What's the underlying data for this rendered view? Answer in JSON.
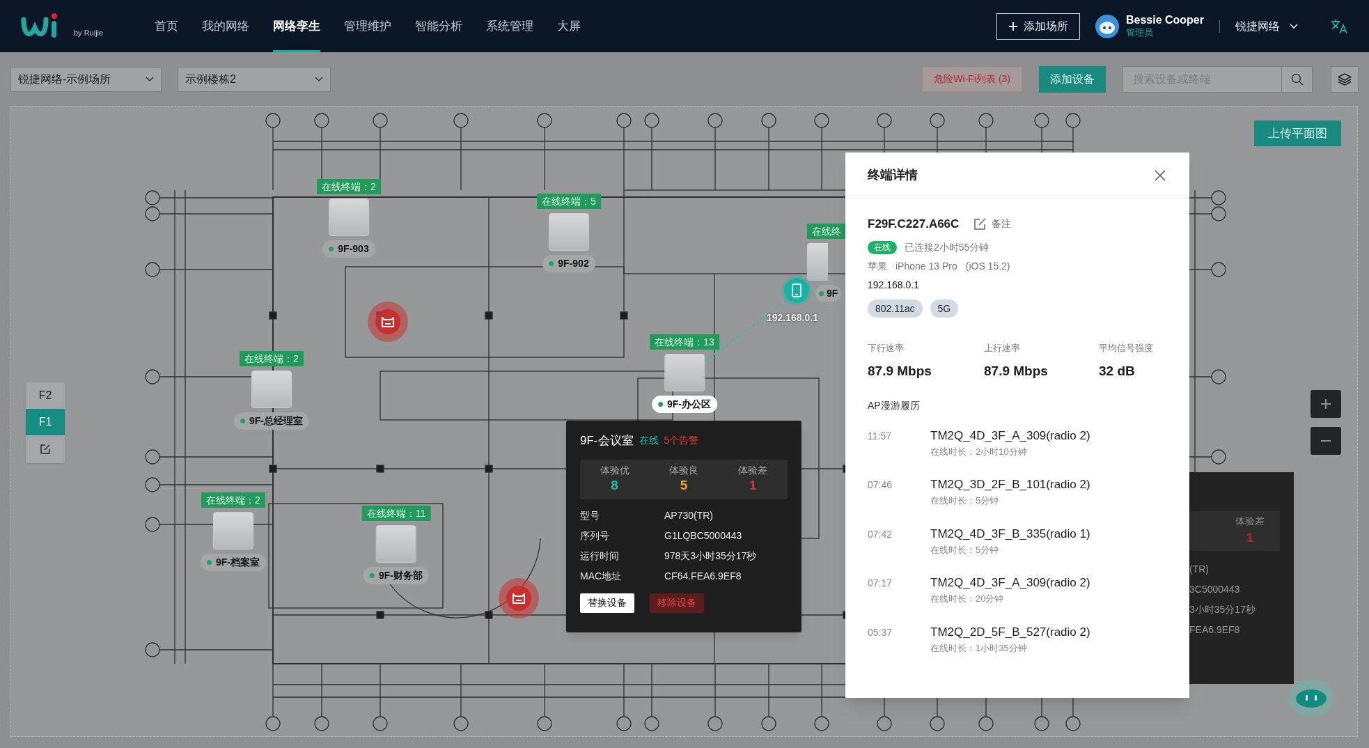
{
  "nav": {
    "logo_caption": "by Ruijie",
    "items": [
      {
        "label": "首页",
        "selected": false
      },
      {
        "label": "我的网络",
        "selected": false
      },
      {
        "label": "网络孪生",
        "selected": true
      },
      {
        "label": "管理维护",
        "selected": false
      },
      {
        "label": "智能分析",
        "selected": false
      },
      {
        "label": "系统管理",
        "selected": false
      },
      {
        "label": "大屏",
        "selected": false
      }
    ],
    "add_site_button": "添加场所",
    "user": {
      "name": "Bessie Cooper",
      "role": "管理员"
    },
    "org": "锐捷网络"
  },
  "toolbar": {
    "site_select": "锐捷网络-示例场所",
    "building_select": "示例楼栋2",
    "wifi_risk_button": "危险Wi-Fi列表 (3)",
    "add_device_button": "添加设备",
    "search": {
      "placeholder": "搜索设备或终端"
    }
  },
  "canvas": {
    "upload_button": "上传平面图",
    "floors": [
      {
        "label": "F2",
        "selected": false
      },
      {
        "label": "F1",
        "selected": true
      }
    ],
    "aps": [
      {
        "name": "9F-903",
        "badge": "在线终端：2",
        "online": true,
        "selected": false
      },
      {
        "name": "9F-902",
        "badge": "在线终端：5",
        "online": true,
        "selected": false
      },
      {
        "name": "9F-总经理室",
        "badge": "在线终端：2",
        "online": true,
        "selected": false
      },
      {
        "name": "9F-档案室",
        "badge": "在线终端：2",
        "online": true,
        "selected": false
      },
      {
        "name": "9F-财务部",
        "badge": "在线终端：11",
        "online": true,
        "selected": false
      },
      {
        "name": "9F-办公区",
        "badge": "在线终端：13",
        "online": true,
        "selected": true
      },
      {
        "name": "9F",
        "badge": "在线终",
        "online": true,
        "selected": false
      }
    ],
    "terminal": {
      "ip": "192.168.0.1"
    }
  },
  "ap_popup": {
    "name": "9F-会议室",
    "status": "在线",
    "alerts": "5个告警",
    "experience": [
      {
        "label": "体验优",
        "value": "8",
        "kind": "good"
      },
      {
        "label": "体验良",
        "value": "5",
        "kind": "fair"
      },
      {
        "label": "体验差",
        "value": "1",
        "kind": "poor"
      }
    ],
    "fields": [
      {
        "label": "型号",
        "value": "AP730(TR)"
      },
      {
        "label": "序列号",
        "value": "G1LQBC5000443"
      },
      {
        "label": "运行时间",
        "value": "978天3小时35分17秒"
      },
      {
        "label": "MAC地址",
        "value": "CF64.FEA6.9EF8"
      }
    ],
    "buttons": [
      {
        "label": "替换设备",
        "kind": "primary"
      },
      {
        "label": "移除设备",
        "kind": "danger"
      }
    ]
  },
  "back_popup": {
    "experience_label": "体验差",
    "experience_value": "1",
    "fields": [
      "(TR)",
      "3C5000443",
      "3小时35分17秒",
      "FEA6.9EF8"
    ]
  },
  "terminal_panel": {
    "title": "终端详情",
    "mac": "F29F.C227.A66C",
    "remark": "备注",
    "status": "在线",
    "connected_for": "已连接2小时55分钟",
    "vendor": "苹果",
    "model": "iPhone 13 Pro",
    "os": "(iOS 15.2)",
    "ip": "192.168.0.1",
    "tags": [
      "802.11ac",
      "5G"
    ],
    "stats": [
      {
        "label": "下行速率",
        "value": "87.9 Mbps"
      },
      {
        "label": "上行速率",
        "value": "87.9 Mbps"
      },
      {
        "label": "平均信号强度",
        "value": "32 dB"
      }
    ],
    "history_title": "AP漫游履历",
    "history": [
      {
        "time": "11:57",
        "ap": "TM2Q_4D_3F_A_309(radio 2)",
        "duration": "在线时长：2小时10分钟"
      },
      {
        "time": "07:46",
        "ap": "TM2Q_3D_2F_B_101(radio 2)",
        "duration": "在线时长：5分钟"
      },
      {
        "time": "07:42",
        "ap": "TM2Q_4D_3F_B_335(radio 1)",
        "duration": "在线时长：5分钟"
      },
      {
        "time": "07:17",
        "ap": "TM2Q_4D_3F_A_309(radio 2)",
        "duration": "在线时长：20分钟"
      },
      {
        "time": "05:37",
        "ap": "TM2Q_2D_5F_B_527(radio 2)",
        "duration": "在线时长：1小时35分钟"
      }
    ]
  }
}
